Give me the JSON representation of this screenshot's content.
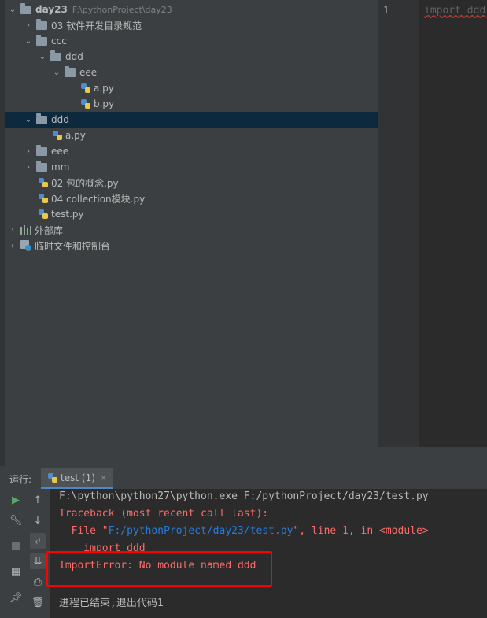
{
  "project_tree": {
    "root": {
      "label": "day23",
      "path": "F:\\pythonProject\\day23"
    },
    "items": [
      {
        "label": "03 软件开发目录规范"
      },
      {
        "label": "ccc"
      },
      {
        "label": "ddd"
      },
      {
        "label": "eee"
      },
      {
        "label": "a.py"
      },
      {
        "label": "b.py"
      },
      {
        "label": "ddd"
      },
      {
        "label": "a.py"
      },
      {
        "label": "eee"
      },
      {
        "label": "mm"
      },
      {
        "label": "02 包的概念.py"
      },
      {
        "label": "04 collection模块.py"
      },
      {
        "label": "test.py"
      },
      {
        "label": "外部库"
      },
      {
        "label": "临时文件和控制台"
      }
    ]
  },
  "editor": {
    "line_number": "1",
    "code": "import ddd"
  },
  "run_panel": {
    "label": "运行:",
    "tab": "test (1)",
    "close": "×"
  },
  "console": {
    "lines": [
      "F:\\python\\python27\\python.exe F:/pythonProject/day23/test.py",
      "Traceback (most recent call last):",
      "  File \"",
      "F:/pythonProject/day23/test.py",
      "\", line 1, in <module>",
      "    import ddd",
      "ImportError: No module named ddd",
      "进程已结束,退出代码1"
    ]
  },
  "colors": {
    "error_text": "#ff6b68",
    "link": "#287bde",
    "highlight_box": "#ff0000",
    "selected_row": "#0d293e"
  }
}
